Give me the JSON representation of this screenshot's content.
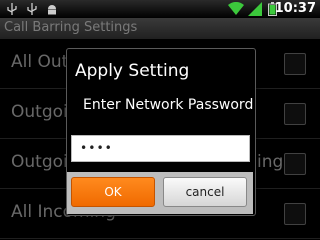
{
  "status_bar": {
    "time": "10:37",
    "icons": [
      "usb-icon",
      "usb-debug-icon",
      "android-icon",
      "wifi-icon",
      "signal-icon",
      "battery-icon"
    ],
    "accent_color": "#3cc83c"
  },
  "title_bar": {
    "title": "Call Barring Settings"
  },
  "list": {
    "items": [
      {
        "label": "All Outgoing"
      },
      {
        "label": "Outgoing International"
      },
      {
        "label": "Outgoing International Roaming"
      },
      {
        "label": "All Incoming"
      }
    ]
  },
  "dialog": {
    "title": "Apply Setting",
    "message": "Enter Network Password",
    "password_value": "••••",
    "ok_label": "OK",
    "cancel_label": "cancel",
    "ok_color": "#f57a0c"
  }
}
